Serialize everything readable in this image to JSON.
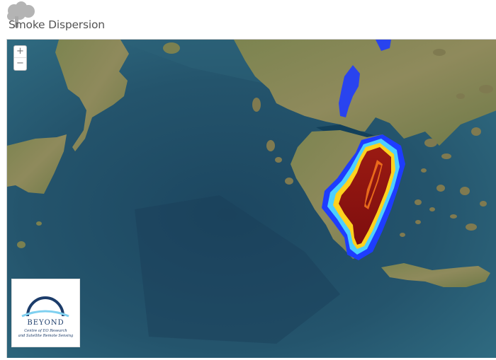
{
  "header": {
    "title": "Smoke Dispersion",
    "logo_icon": "smoke-cloud-icon"
  },
  "map": {
    "zoom_in_label": "+",
    "zoom_out_label": "−",
    "colors": {
      "sea": "#24546c",
      "land": "#8a8a5a",
      "plume_high": "#8e1212",
      "plume_mid": "#ffd21e",
      "plume_low": "#1e3cff"
    }
  },
  "partner": {
    "name": "BEYOND",
    "subtitle_line1": "Centre of EO Research",
    "subtitle_line2": "and Satellite Remote Sensing"
  }
}
